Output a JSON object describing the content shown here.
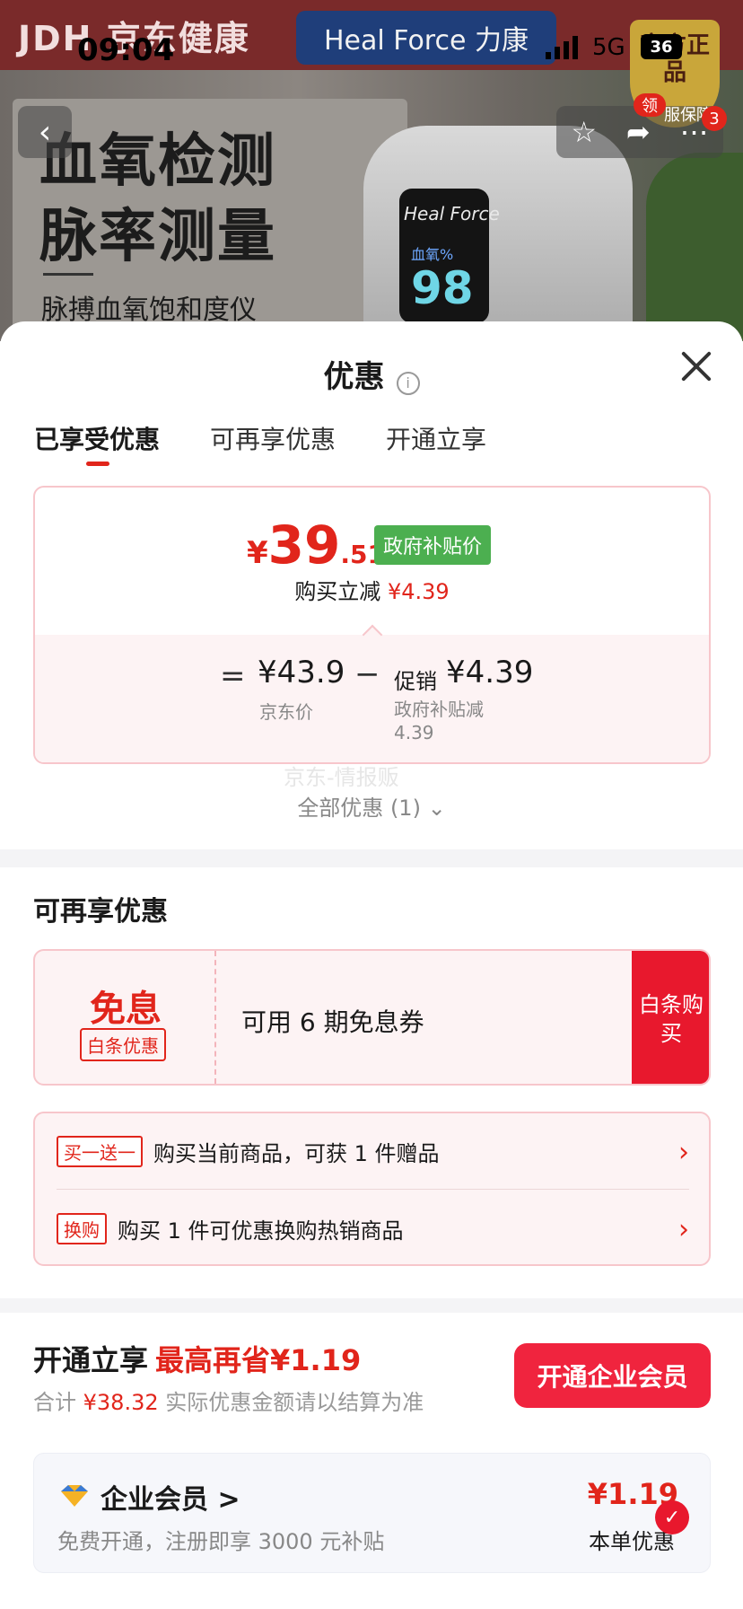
{
  "status_bar": {
    "time": "09:04",
    "network": "5G",
    "battery": "36"
  },
  "banner": {
    "brand_jd": "JDH 京东健康",
    "brand_hf": "Heal Force 力康",
    "headline_1": "血氧检测",
    "headline_2": "脉率测量",
    "subheadline": "脉搏血氧饱和度仪",
    "device_brand": "Heal Force",
    "device_label": "血氧%",
    "device_value": "98",
    "seal_text": "官方正品",
    "ling": "领",
    "guarantee": "服保障",
    "badge_count": "3"
  },
  "sheet": {
    "title": "优惠",
    "tabs": [
      "已享受优惠",
      "可再享优惠",
      "开通立享"
    ]
  },
  "price_card": {
    "symbol": "¥",
    "price_int": "39",
    "price_dec": ".51",
    "gov_tag": "政府补贴价",
    "instant_label": "购买立减",
    "instant_value": "¥4.39",
    "eq": "=",
    "jd_price": "¥43.9",
    "jd_label": "京东价",
    "minus": "−",
    "promo_label": "促销",
    "promo_value": "¥4.39",
    "promo_desc": "政府补贴减 4.39"
  },
  "watermark": "京东-情报贩",
  "all_offers": "全部优惠 (1) ⌄",
  "more_section": {
    "title": "可再享优惠",
    "coupon": {
      "main": "免息",
      "tag": "白条优惠",
      "text": "可用 6 期免息券",
      "button": "白条购买"
    },
    "gift_rows": [
      {
        "tag": "买一送一",
        "text": "购买当前商品，可获 1 件赠品"
      },
      {
        "tag": "换购",
        "text": "购买 1 件可优惠换购热销商品"
      }
    ]
  },
  "vip": {
    "title": "开通立享",
    "save": "最高再省¥1.19",
    "total_label": "合计",
    "total_value": "¥38.32",
    "total_note": "实际优惠金额请以结算为准",
    "button": "开通企业会员",
    "member_name": "企业会员 >",
    "member_desc": "免费开通，注册即享 3000 元补贴",
    "member_price": "¥1.19",
    "member_note": "本单优惠"
  },
  "colors": {
    "accent": "#e1251b",
    "gov_green": "#4caf50"
  }
}
